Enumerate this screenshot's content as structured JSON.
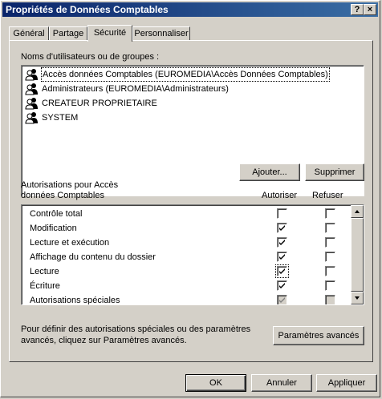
{
  "window": {
    "title": "Propriétés de Données Comptables",
    "help_label": "?",
    "close_label": "×"
  },
  "tabs": [
    {
      "label": "Général",
      "active": false
    },
    {
      "label": "Partage",
      "active": false
    },
    {
      "label": "Sécurité",
      "active": true
    },
    {
      "label": "Personnaliser",
      "active": false
    }
  ],
  "users_section": {
    "label": "Noms d'utilisateurs ou de groupes :",
    "items": [
      {
        "name": "Accès données Comptables (EUROMEDIA\\Accès Données Comptables)",
        "icon": "user-group-icon",
        "selected": true
      },
      {
        "name": "Administrateurs (EUROMEDIA\\Administrateurs)",
        "icon": "user-group-icon",
        "selected": false
      },
      {
        "name": "CREATEUR PROPRIETAIRE",
        "icon": "user-group-icon",
        "selected": false
      },
      {
        "name": "SYSTEM",
        "icon": "user-group-icon",
        "selected": false
      }
    ],
    "add_label": "Ajouter...",
    "remove_label": "Supprimer"
  },
  "permissions": {
    "label_line1": "Autorisations pour Accès",
    "label_line2": "données Comptables",
    "col_allow": "Autoriser",
    "col_deny": "Refuser",
    "rows": [
      {
        "name": "Contrôle total",
        "allow": false,
        "deny": false
      },
      {
        "name": "Modification",
        "allow": true,
        "deny": false
      },
      {
        "name": "Lecture et exécution",
        "allow": true,
        "deny": false
      },
      {
        "name": "Affichage du contenu du dossier",
        "allow": true,
        "deny": false
      },
      {
        "name": "Lecture",
        "allow": true,
        "deny": false
      },
      {
        "name": "Écriture",
        "allow": true,
        "deny": false
      },
      {
        "name": "Autorisations spéciales",
        "allow": true,
        "deny": false,
        "disabled": true
      }
    ]
  },
  "advanced": {
    "text_line1": "Pour définir des autorisations spéciales ou des paramètres",
    "text_line2": "avancés, cliquez sur Paramètres avancés.",
    "button_label": "Paramètres avancés"
  },
  "footer": {
    "ok_label": "OK",
    "cancel_label": "Annuler",
    "apply_label": "Appliquer"
  }
}
